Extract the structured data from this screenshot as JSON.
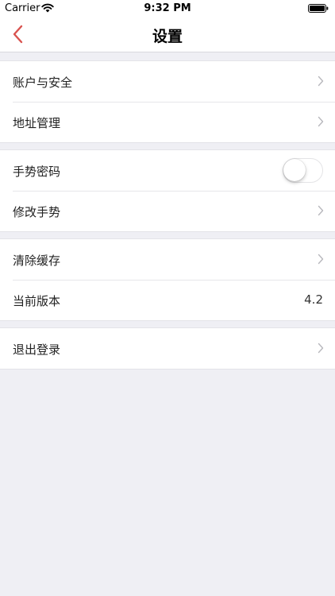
{
  "status_bar": {
    "carrier": "Carrier",
    "time": "9:32 PM"
  },
  "nav": {
    "title": "设置",
    "accent_color": "#d9534f"
  },
  "groups": [
    {
      "items": [
        {
          "label": "账户与安全",
          "accessory": "chevron"
        },
        {
          "label": "地址管理",
          "accessory": "chevron"
        }
      ]
    },
    {
      "items": [
        {
          "label": "手势密码",
          "accessory": "toggle",
          "toggle_on": false
        },
        {
          "label": "修改手势",
          "accessory": "chevron"
        }
      ]
    },
    {
      "items": [
        {
          "label": "清除缓存",
          "accessory": "chevron"
        },
        {
          "label": "当前版本",
          "accessory": "value",
          "value": "4.2"
        }
      ]
    },
    {
      "items": [
        {
          "label": "退出登录",
          "accessory": "chevron"
        }
      ]
    }
  ]
}
